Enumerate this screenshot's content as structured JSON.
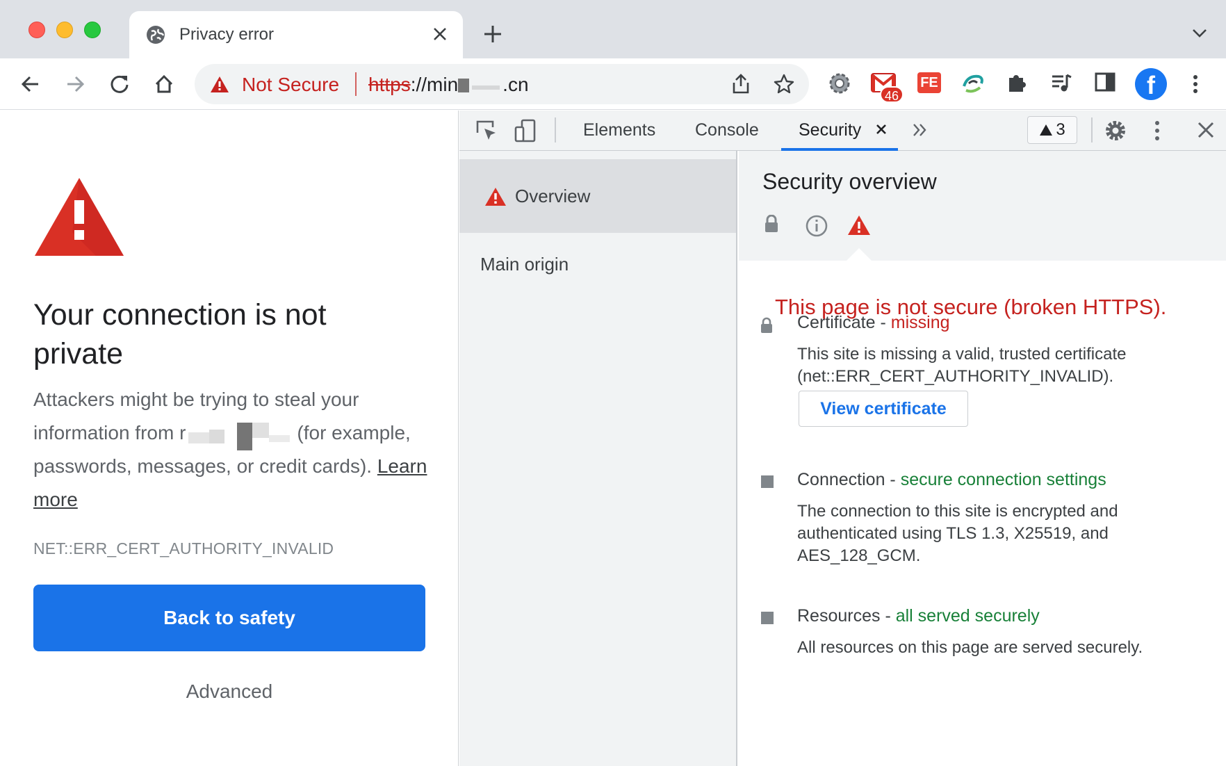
{
  "window": {
    "tab": {
      "title": "Privacy error"
    }
  },
  "toolbar": {
    "security_status": "Not Secure",
    "url_scheme": "https",
    "url_sep": "://",
    "url_host_start": "min",
    "url_host_end": ".cn",
    "extensions": [
      {
        "icon": "settings-gear-extension-icon"
      },
      {
        "icon": "gmail-extension-icon",
        "badge": "46"
      },
      {
        "icon": "fe-extension-icon",
        "label": "FE"
      },
      {
        "icon": "swirl-extension-icon"
      },
      {
        "icon": "puzzle-extensions-icon"
      },
      {
        "icon": "media-controls-icon"
      },
      {
        "icon": "side-panel-icon"
      }
    ],
    "profile_letter": "f"
  },
  "page": {
    "heading": "Your connection is not private",
    "desc_before": "Attackers might be trying to steal your information from ",
    "desc_host_start": "r",
    "desc_after": "(for example, passwords, messages, or credit cards). ",
    "learn_more": "Learn more",
    "error_code": "NET::ERR_CERT_AUTHORITY_INVALID",
    "back_button": "Back to safety",
    "advanced_button": "Advanced"
  },
  "devtools": {
    "tabs": [
      {
        "label": "Elements"
      },
      {
        "label": "Console"
      },
      {
        "label": "Security",
        "active": true
      }
    ],
    "issues_count": "3",
    "sidebar": {
      "overview": "Overview",
      "main_origin": "Main origin"
    },
    "main": {
      "title": "Security overview",
      "headline": "This page is not secure (broken HTTPS).",
      "certificate": {
        "label": "Certificate - ",
        "status": "missing",
        "body": "This site is missing a valid, trusted certificate (net::ERR_CERT_AUTHORITY_INVALID).",
        "button": "View certificate"
      },
      "connection": {
        "label": "Connection - ",
        "status": "secure connection settings",
        "body": "The connection to this site is encrypted and authenticated using TLS 1.3, X25519, and AES_128_GCM."
      },
      "resources": {
        "label": "Resources - ",
        "status": "all served securely",
        "body": "All resources on this page are served securely."
      }
    }
  },
  "colors": {
    "accent": "#1a73e8",
    "danger": "#c5221f",
    "secure": "#188038",
    "warning_icon": "#d93025"
  }
}
